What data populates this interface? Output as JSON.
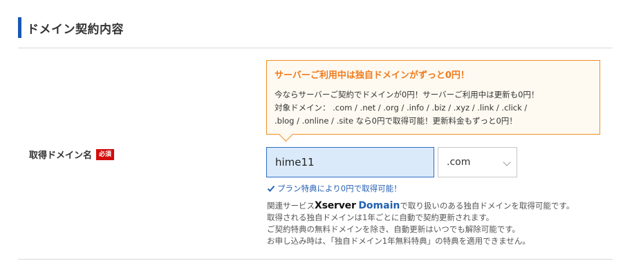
{
  "section": {
    "title": "ドメイン契約内容"
  },
  "field": {
    "label": "取得ドメイン名",
    "required_badge": "必須"
  },
  "promo": {
    "title": "サーバーご利用中は独自ドメインがずっと0円！",
    "lines": [
      "今ならサーバーご契約でドメインが0円！サーバーご利用中は更新も0円！",
      "対象ドメイン：  .com / .net / .org / .info / .biz / .xyz / .link / .click /",
      ".blog / .online / .site なら0円で取得可能！更新料金もずっと0円！"
    ]
  },
  "domain_input": {
    "value": "hime11"
  },
  "tld_select": {
    "selected": ".com"
  },
  "plan_note": "プラン特典により0円で取得可能！",
  "notes": {
    "line1_prefix": "関連サービス",
    "brand_x": "Xserver",
    "brand_domain": "Domain",
    "line1_suffix": "で取り扱いのある独自ドメインを取得可能です。",
    "line2": "取得される独自ドメインは1年ごとに自動で契約更新されます。",
    "line3": "ご契約特典の無料ドメインを除き、自動更新はいつでも解除可能です。",
    "line4": "お申し込み時は、「独自ドメイン1年無料特典」の特典を適用できません。"
  },
  "colors": {
    "accent": "#1a57b5",
    "promo_border": "#f08d26",
    "promo_title": "#f07b1d",
    "required": "#d30c0c",
    "link_blue": "#2a62b5"
  },
  "icons": {
    "check": "check-icon",
    "chevron": "chevron-down-icon"
  }
}
